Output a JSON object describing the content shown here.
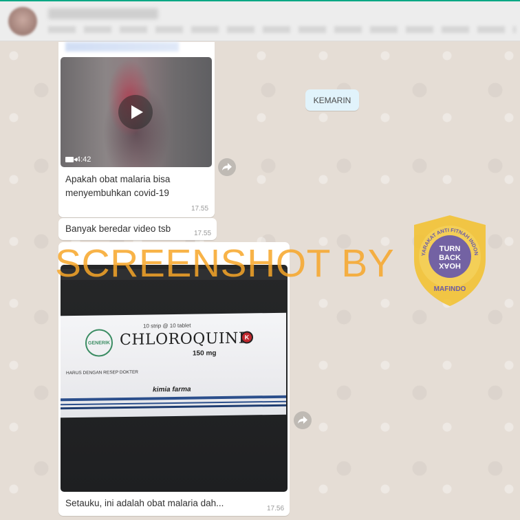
{
  "date_chip": "KEMARIN",
  "messages": [
    {
      "type": "video",
      "duration": "4:42",
      "caption": "Apakah obat malaria bisa menyembuhkan covid-19",
      "time": "17.55"
    },
    {
      "type": "text",
      "text": "Banyak beredar video tsb",
      "time": "17.55"
    },
    {
      "type": "image",
      "caption": "Setauku, ini adalah obat malaria dah...",
      "time": "17.56",
      "photo": {
        "strip_text": "10 strip @ 10 tablet",
        "brand": "CHLOROQUINE",
        "dose": "150 mg",
        "rx_note": "HARUS DENGAN RESEP DOKTER",
        "maker": "kimia farma",
        "logo": "GENERIK",
        "k_mark": "K"
      }
    }
  ],
  "overlay": {
    "watermark": "SCREENSHOT BY",
    "badge_ring_text": "MASYARAKAT ANTI FITNAH INDONESIA",
    "badge_center": [
      "TURN",
      "BACK",
      "HOAX"
    ],
    "badge_bottom": "MAFINDO"
  },
  "colors": {
    "chat_background": "#e5ddd5",
    "bubble": "#ffffff",
    "date_chip": "#e1f3fb",
    "watermark": "#f7a628",
    "badge_outer": "#f2c230",
    "badge_inner": "#6b5ca8",
    "accent": "#00a884"
  },
  "icons": {
    "video_play": "play-icon",
    "video_camera": "video-camera-icon",
    "forward": "forward-icon"
  }
}
